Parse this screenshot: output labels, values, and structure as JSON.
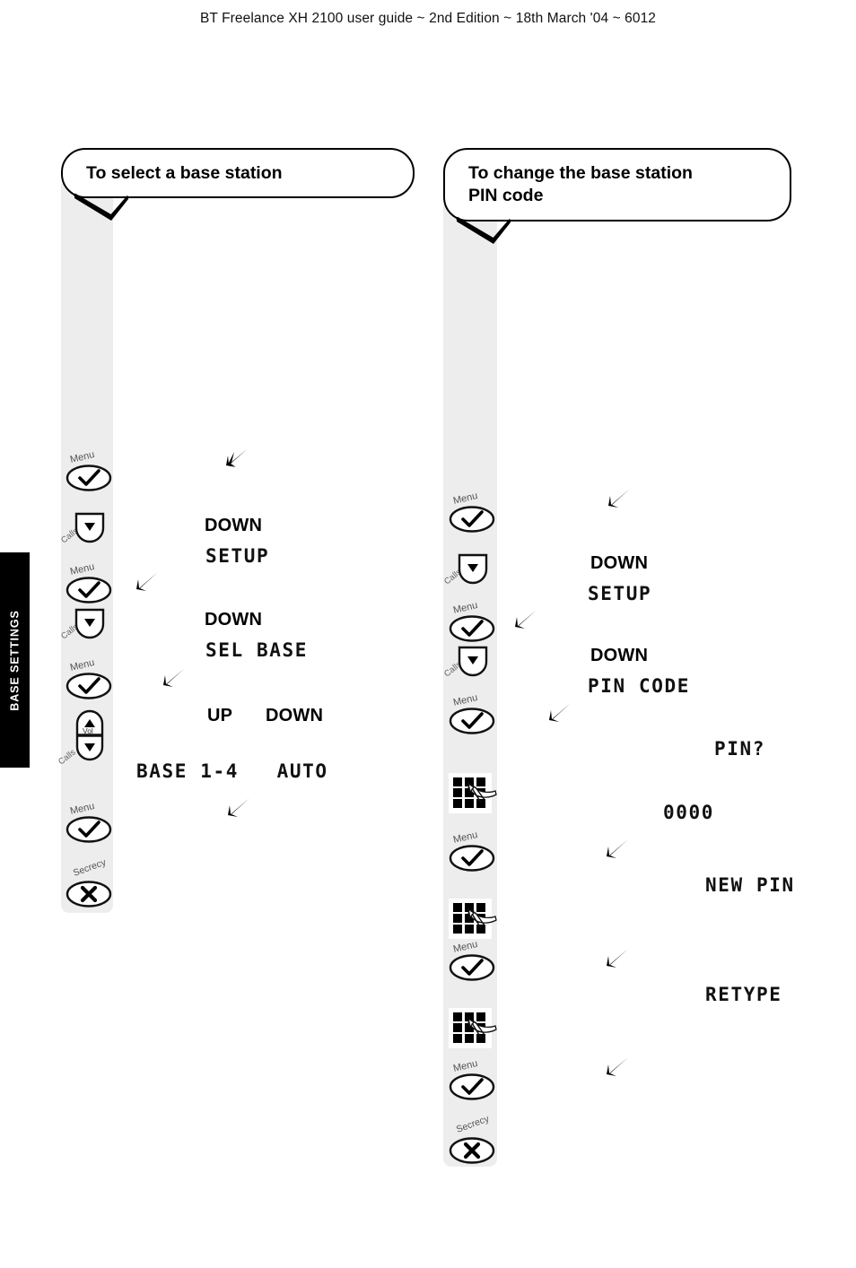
{
  "header": {
    "running_text": "BT Freelance XH 2100 user guide ~ 2nd Edition ~ 18th March '04 ~ 6012"
  },
  "section_tab": {
    "label": "BASE SETTINGS",
    "color": "#000000",
    "text_color": "#ffffff"
  },
  "columns": [
    {
      "id": "select-base-station",
      "title": "To select a base station",
      "keys": [
        {
          "type": "menu",
          "label": "Menu"
        },
        {
          "type": "calls",
          "label": "Calls"
        },
        {
          "type": "menu",
          "label": "Menu"
        },
        {
          "type": "calls",
          "label": "Calls"
        },
        {
          "type": "menu",
          "label": "Menu"
        },
        {
          "type": "updown",
          "label_up": "Vol",
          "label_down": "Calls"
        },
        {
          "type": "menu",
          "label": "Menu"
        },
        {
          "type": "secrecy",
          "label": "Secrecy"
        }
      ],
      "captions": [
        {
          "text": "DOWN"
        },
        {
          "text": "DOWN"
        },
        {
          "text": "UP"
        },
        {
          "text": "DOWN"
        }
      ],
      "lcd": [
        {
          "text": "SETUP"
        },
        {
          "text": "SEL BASE"
        },
        {
          "text": "BASE 1-4   AUTO"
        }
      ]
    },
    {
      "id": "change-base-pin",
      "title": "To change the base station\nPIN code",
      "keys": [
        {
          "type": "menu",
          "label": "Menu"
        },
        {
          "type": "calls",
          "label": "Calls"
        },
        {
          "type": "menu",
          "label": "Menu"
        },
        {
          "type": "calls",
          "label": "Calls"
        },
        {
          "type": "menu",
          "label": "Menu"
        },
        {
          "type": "keypad",
          "label": "keypad"
        },
        {
          "type": "menu",
          "label": "Menu"
        },
        {
          "type": "keypad",
          "label": "keypad"
        },
        {
          "type": "menu",
          "label": "Menu"
        },
        {
          "type": "keypad",
          "label": "keypad"
        },
        {
          "type": "menu",
          "label": "Menu"
        },
        {
          "type": "secrecy",
          "label": "Secrecy"
        }
      ],
      "captions": [
        {
          "text": "DOWN"
        },
        {
          "text": "DOWN"
        }
      ],
      "lcd": [
        {
          "text": "SETUP"
        },
        {
          "text": "PIN CODE"
        },
        {
          "text": "PIN?"
        },
        {
          "text": "0000"
        },
        {
          "text": "NEW PIN"
        },
        {
          "text": "RETYPE"
        }
      ]
    }
  ]
}
